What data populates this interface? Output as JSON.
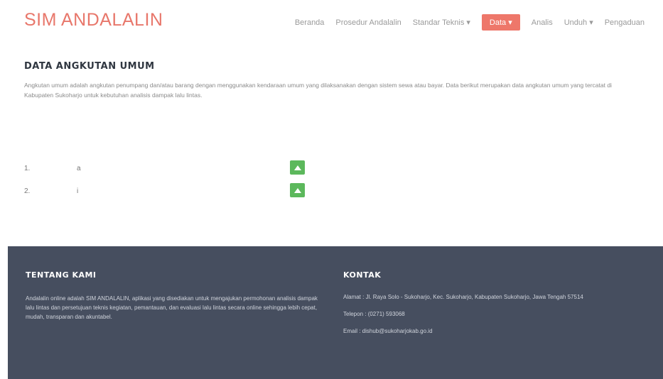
{
  "brand": "SIM ANDALALIN",
  "nav": {
    "items": [
      {
        "label": "Beranda"
      },
      {
        "label": "Prosedur Andalalin"
      },
      {
        "label": "Standar Teknis ▾"
      },
      {
        "label": "Data ▾",
        "active": true
      },
      {
        "label": "Analis"
      },
      {
        "label": "Unduh ▾"
      },
      {
        "label": "Pengaduan"
      }
    ]
  },
  "page": {
    "title": "DATA ANGKUTAN UMUM",
    "description": "Angkutan umum adalah angkutan penumpang dan/atau barang dengan menggunakan kendaraan umum yang dilaksanakan dengan sistem sewa atau bayar. Data berikut merupakan data angkutan umum yang tercatat di Kabupaten Sukoharjo untuk kebutuhan analisis dampak lalu lintas."
  },
  "table": {
    "rows": [
      {
        "no": "1.",
        "value": "a"
      },
      {
        "no": "2.",
        "value": "i"
      }
    ]
  },
  "footer": {
    "about": {
      "title": "TENTANG KAMI",
      "text": "Andalalin online adalah SIM ANDALALIN, aplikasi yang disediakan untuk mengajukan permohonan analisis dampak lalu lintas dan persetujuan teknis kegiatan, pemantauan, dan evaluasi lalu lintas secara online sehingga lebih cepat, mudah, transparan dan akuntabel."
    },
    "contact": {
      "title": "KONTAK",
      "address": "Alamat  :  Jl. Raya Solo - Sukoharjo, Kec. Sukoharjo, Kabupaten Sukoharjo, Jawa Tengah 57514",
      "phone": "Telepon  :  (0271) 593068",
      "email": "Email  :  dishub@sukoharjokab.go.id"
    }
  }
}
